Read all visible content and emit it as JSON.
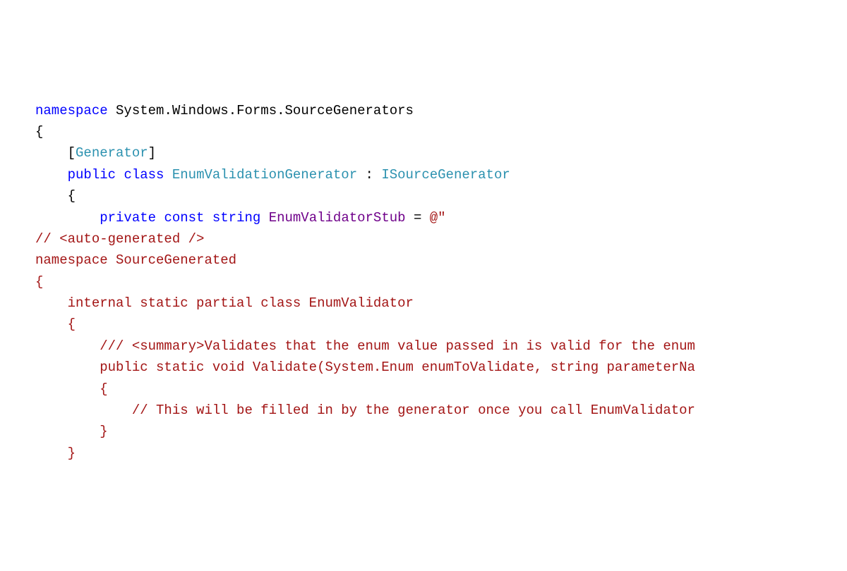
{
  "colors": {
    "keyword": "#0000ff",
    "type": "#2b91af",
    "string": "#a31515",
    "field": "#6f008a",
    "text": "#000000"
  },
  "code": {
    "line1": {
      "namespace_kw": "namespace",
      "ns_part1": "System",
      "ns_part2": "Windows",
      "ns_part3": "Forms",
      "ns_part4": "SourceGenerators"
    },
    "line2": {
      "brace": "{"
    },
    "line3": {
      "lbracket": "[",
      "attr": "Generator",
      "rbracket": "]"
    },
    "line4": {
      "public_kw": "public",
      "class_kw": "class",
      "class_name": "EnumValidationGenerator",
      "colon": " : ",
      "iface": "ISourceGenerator"
    },
    "line5": {
      "brace": "{"
    },
    "line6": {
      "private_kw": "private",
      "const_kw": "const",
      "string_kw": "string",
      "field_name": "EnumValidatorStub",
      "equals": " = ",
      "verbatim": "@\""
    },
    "line7": {
      "text": "// <auto-generated />"
    },
    "line8": {
      "text": "namespace SourceGenerated"
    },
    "line9": {
      "text": "{"
    },
    "line10": {
      "text": "    internal static partial class EnumValidator"
    },
    "line11": {
      "text": "    {"
    },
    "line12": {
      "text": "        /// <summary>Validates that the enum value passed in is valid for the enum"
    },
    "line13": {
      "text": "        public static void Validate(System.Enum enumToValidate, string parameterNa"
    },
    "line14": {
      "text": "        {"
    },
    "line15": {
      "text": "            // This will be filled in by the generator once you call EnumValidator"
    },
    "line16": {
      "text": "        }"
    },
    "line17": {
      "text": "    }"
    }
  }
}
